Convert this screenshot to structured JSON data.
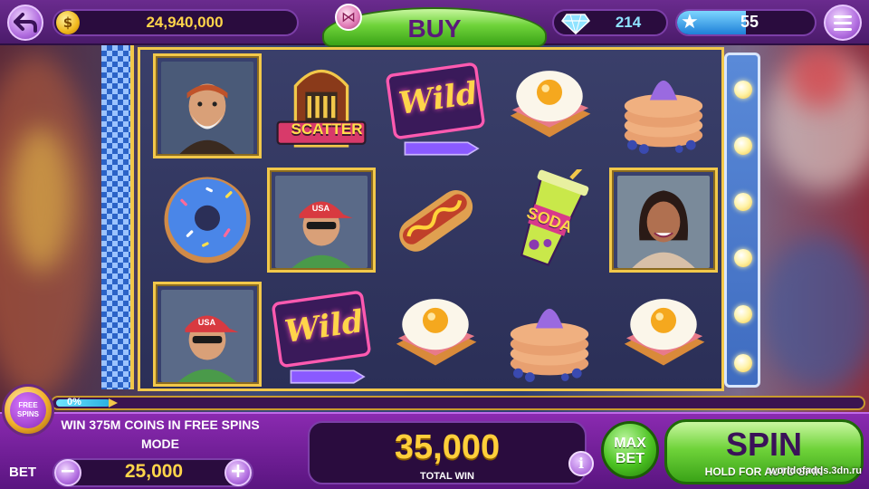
{
  "colors": {
    "accent_purple": "#6a2b8e",
    "gold": "#f2c84a",
    "coin_text": "#ffd54a",
    "gem_text": "#8fe3ff",
    "spin_green": "#6fd33a"
  },
  "top_bar": {
    "back_icon": "back-arrow-icon",
    "coins": "24,940,000",
    "coin_icon": "dollar-coin-icon",
    "buy_label": "BUY",
    "buy_icon": "gift-bow-icon",
    "gems": "214",
    "gem_icon": "diamond-icon",
    "level": "55",
    "level_icon": "star-icon",
    "level_progress_percent": 50,
    "menu_icon": "hamburger-menu-icon"
  },
  "reels": {
    "columns": [
      [
        "bearded-biker-portrait",
        "blue-donut",
        "usa-cap-man-portrait"
      ],
      [
        "jukebox-scatter",
        "usa-cap-man-portrait",
        "wild-neon-sign"
      ],
      [
        "wild-neon-sign",
        "hot-dog",
        "fried-egg-sandwich"
      ],
      [
        "fried-egg-sandwich",
        "soda-cup",
        "blueberry-pancakes"
      ],
      [
        "blueberry-pancakes",
        "smiling-woman-portrait",
        "fried-egg-sandwich"
      ]
    ],
    "labels": {
      "scatter": "SCATTER",
      "wild": "Wild",
      "soda": "SODA",
      "usa": "USA"
    }
  },
  "free_spins": {
    "badge_label": "FREE SPINS",
    "progress_label": "0%",
    "progress_percent": 0,
    "promo_text": "WIN 375M COINS IN FREE SPINS MODE"
  },
  "bet": {
    "label": "BET",
    "value": "25,000",
    "minus_label": "−",
    "plus_label": "+"
  },
  "total_win": {
    "value": "35,000",
    "label": "TOTAL WIN",
    "info_label": "i"
  },
  "buttons": {
    "max_bet_line1": "MAX",
    "max_bet_line2": "BET",
    "spin_label": "SPIN",
    "spin_sub": "HOLD FOR AUTO SPIN"
  },
  "watermark": "worldofadds.3dn.ru"
}
